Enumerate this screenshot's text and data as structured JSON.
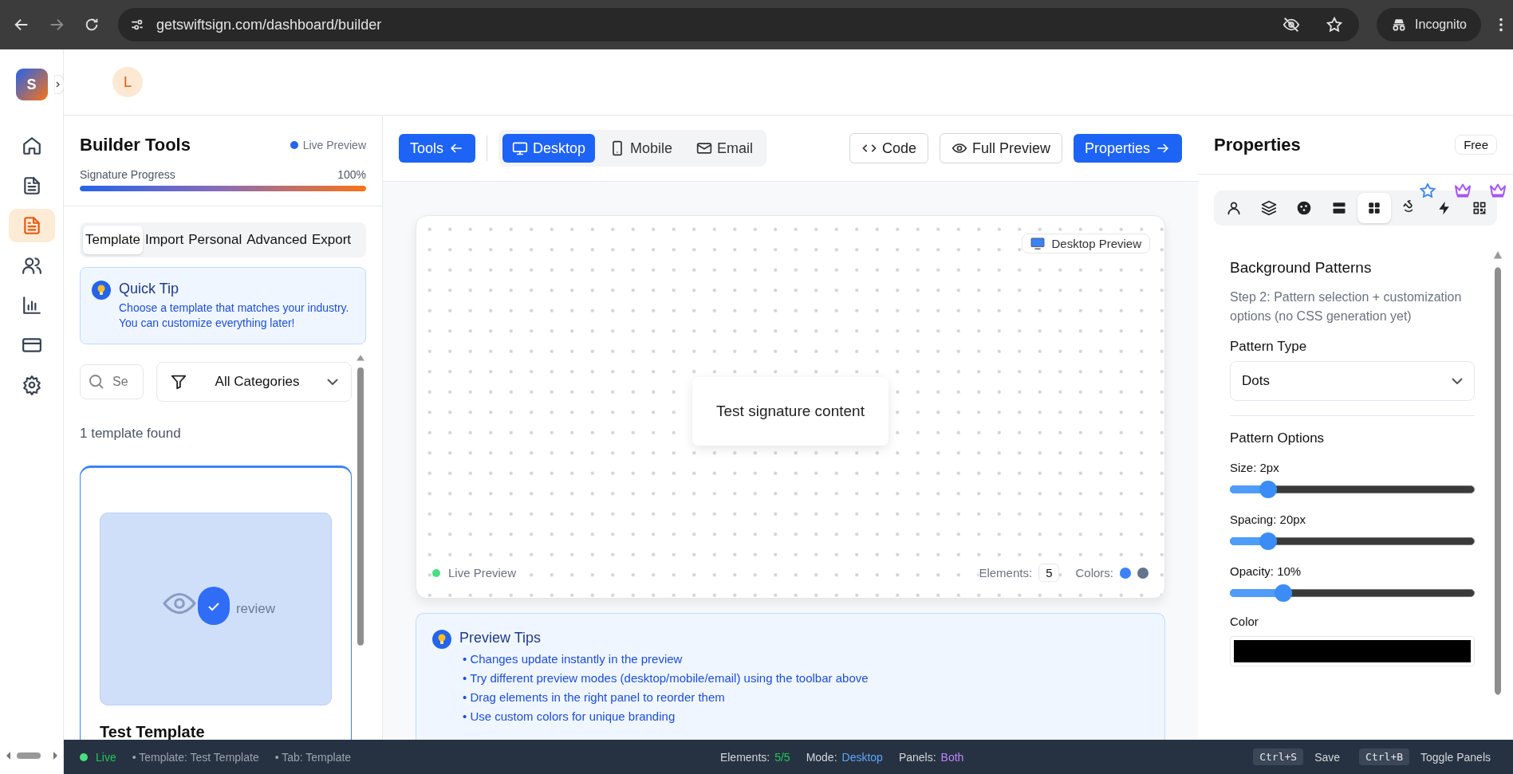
{
  "browser": {
    "url": "getswiftsign.com/dashboard/builder",
    "forward_disabled": true,
    "profile": "Incognito"
  },
  "app": {
    "logo": "S",
    "avatar": "L"
  },
  "nav": [
    {
      "kind": "home",
      "selected": false
    },
    {
      "kind": "file",
      "selected": false
    },
    {
      "kind": "file",
      "selected": true
    },
    {
      "kind": "users",
      "selected": false
    },
    {
      "kind": "chart",
      "selected": false
    },
    {
      "kind": "card",
      "selected": false
    },
    {
      "kind": "settings",
      "selected": false
    }
  ],
  "left_panel": {
    "title": "Builder Tools",
    "live_label": "Live Preview",
    "progress": {
      "label": "Signature Progress",
      "reading": "100%",
      "level": 1
    },
    "tabs": [
      {
        "label": "Template",
        "selected": true
      },
      {
        "label": "Import",
        "selected": false
      },
      {
        "label": "Personal",
        "selected": false
      },
      {
        "label": "Advanced",
        "selected": false
      },
      {
        "label": "Export",
        "selected": false
      }
    ],
    "tip": {
      "title": "Quick Tip",
      "text": "Choose a template that matches your industry. You can customize everything later!"
    },
    "search": {
      "placeholder": "Se"
    },
    "filter": {
      "value": "All Categories"
    },
    "count": "1 template found",
    "templates": [
      {
        "name": "Test Template",
        "preview_label": "review",
        "selected": true
      }
    ]
  },
  "toolbar": {
    "tools": "Tools",
    "modes": [
      {
        "kind": "desktop",
        "label": "Desktop",
        "selected": true
      },
      {
        "kind": "mobile",
        "label": "Mobile",
        "selected": false
      },
      {
        "kind": "email",
        "label": "Email",
        "selected": false
      }
    ],
    "code": "Code",
    "full_preview": "Full Preview",
    "properties": "Properties"
  },
  "preview": {
    "badge": "Desktop Preview",
    "content": "Test signature content",
    "status": "Live Preview",
    "elements_label": "Elements:",
    "elements": "5",
    "colors_label": "Colors:",
    "colors": [
      {
        "color": "#3b82f6"
      },
      {
        "color": "#64748b"
      }
    ]
  },
  "tips": {
    "title": "Preview Tips",
    "items": [
      "• Changes update instantly in the preview",
      "• Try different preview modes (desktop/mobile/email) using the toolbar above",
      "• Drag elements in the right panel to reorder them",
      "• Use custom colors for unique branding"
    ]
  },
  "properties": {
    "title": "Properties",
    "plan": "Free",
    "tabs": [
      {
        "kind": "user",
        "selected": false,
        "starred": false,
        "premium": false
      },
      {
        "kind": "layers",
        "selected": false,
        "starred": false,
        "premium": false
      },
      {
        "kind": "palette",
        "selected": false,
        "starred": false,
        "premium": false
      },
      {
        "kind": "rows",
        "selected": false,
        "starred": false,
        "premium": false
      },
      {
        "kind": "grid",
        "selected": true,
        "starred": false,
        "premium": false
      },
      {
        "kind": "magnet",
        "selected": false,
        "starred": true,
        "premium": false
      },
      {
        "kind": "bolt",
        "selected": false,
        "starred": false,
        "premium": true
      },
      {
        "kind": "qr",
        "selected": false,
        "starred": false,
        "premium": true
      }
    ],
    "section_title": "Background Patterns",
    "description": "Step 2: Pattern selection + customization options (no CSS generation yet)",
    "pattern_type_label": "Pattern Type",
    "pattern_type": "Dots",
    "options_title": "Pattern Options",
    "sliders": [
      {
        "label": "Size: 2px",
        "level": 0.13
      },
      {
        "label": "Spacing: 20px",
        "level": 0.13
      },
      {
        "label": "Opacity: 10%",
        "level": 0.2
      }
    ],
    "color_label": "Color",
    "color": "#000000"
  },
  "status_bar": {
    "live": "Live",
    "template": "• Template: Test Template",
    "tab": "• Tab: Template",
    "elements_label": "Elements:",
    "elements": "5/5",
    "mode_label": "Mode:",
    "mode": "Desktop",
    "panels_label": "Panels:",
    "panels": "Both",
    "shortcuts": [
      {
        "keys": "Ctrl+S",
        "label": "Save"
      },
      {
        "keys": "Ctrl+B",
        "label": "Toggle Panels"
      }
    ]
  }
}
